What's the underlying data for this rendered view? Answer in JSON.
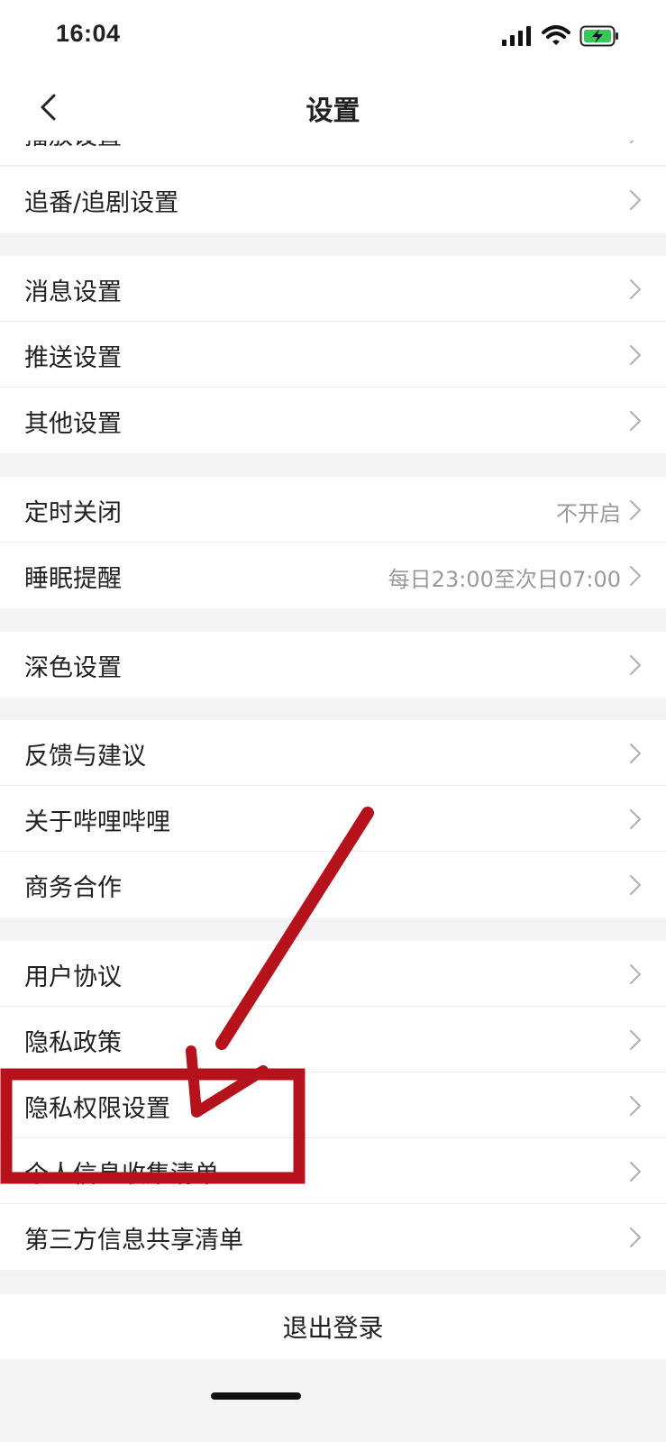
{
  "status_bar": {
    "time": "16:04"
  },
  "nav": {
    "title": "设置"
  },
  "rows": {
    "r0": {
      "label": "播放设置"
    },
    "r1": {
      "label": "追番/追剧设置"
    },
    "r2": {
      "label": "消息设置"
    },
    "r3": {
      "label": "推送设置"
    },
    "r4": {
      "label": "其他设置"
    },
    "r5": {
      "label": "定时关闭",
      "value": "不开启"
    },
    "r6": {
      "label": "睡眠提醒",
      "value": "每日23:00至次日07:00"
    },
    "r7": {
      "label": "深色设置"
    },
    "r8": {
      "label": "反馈与建议"
    },
    "r9": {
      "label": "关于哔哩哔哩"
    },
    "r10": {
      "label": "商务合作"
    },
    "r11": {
      "label": "用户协议"
    },
    "r12": {
      "label": "隐私政策"
    },
    "r13": {
      "label": "隐私权限设置"
    },
    "r14": {
      "label": "个人信息收集清单"
    },
    "r15": {
      "label": "第三方信息共享清单"
    }
  },
  "logout": {
    "label": "退出登录"
  },
  "colors": {
    "annotation": "#b5121b",
    "background": "#f4f4f6"
  },
  "icons": [
    "back-icon",
    "chevron-right-icon",
    "signal-icon",
    "wifi-icon",
    "battery-icon"
  ]
}
